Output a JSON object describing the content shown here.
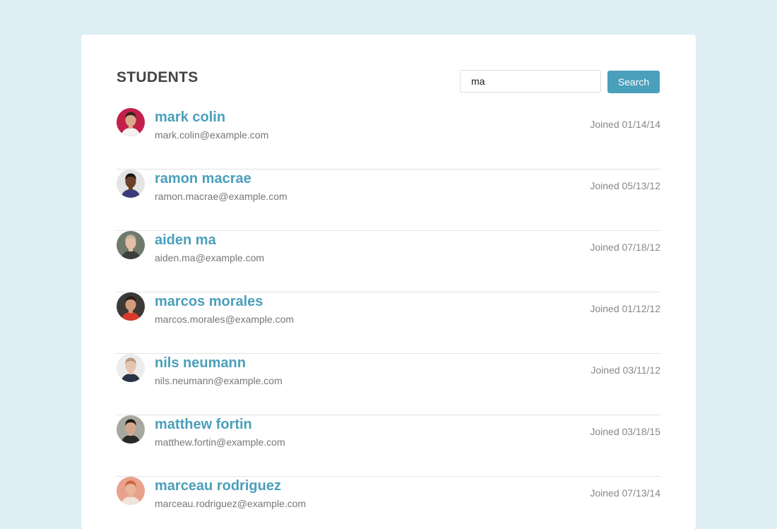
{
  "header": {
    "title": "STUDENTS"
  },
  "search": {
    "value": "ma",
    "button_label": "Search"
  },
  "students": [
    {
      "name": "mark colin",
      "email": "mark.colin@example.com",
      "joined": "Joined 01/14/14",
      "avatar_colors": {
        "bg": "#c2204a",
        "skin": "#d9a98c",
        "hair": "#3a2418",
        "shirt": "#f2f2f2"
      }
    },
    {
      "name": "ramon macrae",
      "email": "ramon.macrae@example.com",
      "joined": "Joined 05/13/12",
      "avatar_colors": {
        "bg": "#e4e4e4",
        "skin": "#6b4228",
        "hair": "#1e140e",
        "shirt": "#3b3a7a"
      }
    },
    {
      "name": "aiden ma",
      "email": "aiden.ma@example.com",
      "joined": "Joined 07/18/12",
      "avatar_colors": {
        "bg": "#6f7a6d",
        "skin": "#e2bfa6",
        "hair": "#c9b39a",
        "shirt": "#3e3e3e"
      }
    },
    {
      "name": "marcos morales",
      "email": "marcos.morales@example.com",
      "joined": "Joined 01/12/12",
      "avatar_colors": {
        "bg": "#3c3a36",
        "skin": "#d49c7e",
        "hair": "#2b1d14",
        "shirt": "#d83a2c"
      }
    },
    {
      "name": "nils neumann",
      "email": "nils.neumann@example.com",
      "joined": "Joined 03/11/12",
      "avatar_colors": {
        "bg": "#ececec",
        "skin": "#e6c4ae",
        "hair": "#b39a84",
        "shirt": "#2a3346"
      }
    },
    {
      "name": "matthew fortin",
      "email": "matthew.fortin@example.com",
      "joined": "Joined 03/18/15",
      "avatar_colors": {
        "bg": "#a7a9a0",
        "skin": "#d2a88c",
        "hair": "#241a14",
        "shirt": "#2a2a2a"
      }
    },
    {
      "name": "marceau rodriguez",
      "email": "marceau.rodriguez@example.com",
      "joined": "Joined 07/13/14",
      "avatar_colors": {
        "bg": "#e9a08c",
        "skin": "#e8b49a",
        "hair": "#c8643c",
        "shirt": "#f0e4dc"
      }
    }
  ]
}
